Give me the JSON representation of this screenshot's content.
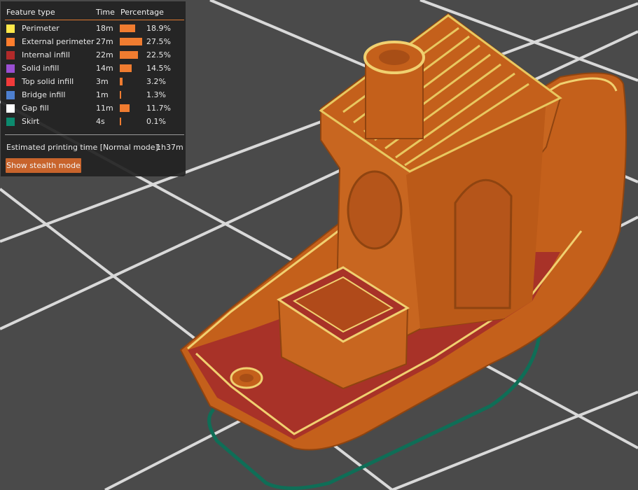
{
  "legend": {
    "headers": {
      "feature": "Feature type",
      "time": "Time",
      "percentage": "Percentage"
    },
    "rows": [
      {
        "name": "Perimeter",
        "time": "18m",
        "percent": "18.9%",
        "value": 18.9,
        "color": "#ffe84a"
      },
      {
        "name": "External perimeter",
        "time": "27m",
        "percent": "27.5%",
        "value": 27.5,
        "color": "#ff7e2e"
      },
      {
        "name": "Internal infill",
        "time": "22m",
        "percent": "22.5%",
        "value": 22.5,
        "color": "#b22a2a"
      },
      {
        "name": "Solid infill",
        "time": "14m",
        "percent": "14.5%",
        "value": 14.5,
        "color": "#9a4fd2"
      },
      {
        "name": "Top solid infill",
        "time": "3m",
        "percent": "3.2%",
        "value": 3.2,
        "color": "#f23a3a"
      },
      {
        "name": "Bridge infill",
        "time": "1m",
        "percent": "1.3%",
        "value": 1.3,
        "color": "#4d7fcf"
      },
      {
        "name": "Gap fill",
        "time": "11m",
        "percent": "11.7%",
        "value": 11.7,
        "color": "#ffffff"
      },
      {
        "name": "Skirt",
        "time": "4s",
        "percent": "0.1%",
        "value": 0.1,
        "color": "#0c8a6e"
      }
    ],
    "estimate_label": "Estimated printing time [Normal mode]:",
    "estimate_value": "1h37m",
    "stealth_button": "Show stealth mode"
  },
  "colors": {
    "background": "#4a4a4a",
    "grid": "#d8d8d8",
    "model": "#c7611c",
    "infill": "#a83228",
    "skirt": "#0e6e56",
    "accent": "#f07c30"
  }
}
